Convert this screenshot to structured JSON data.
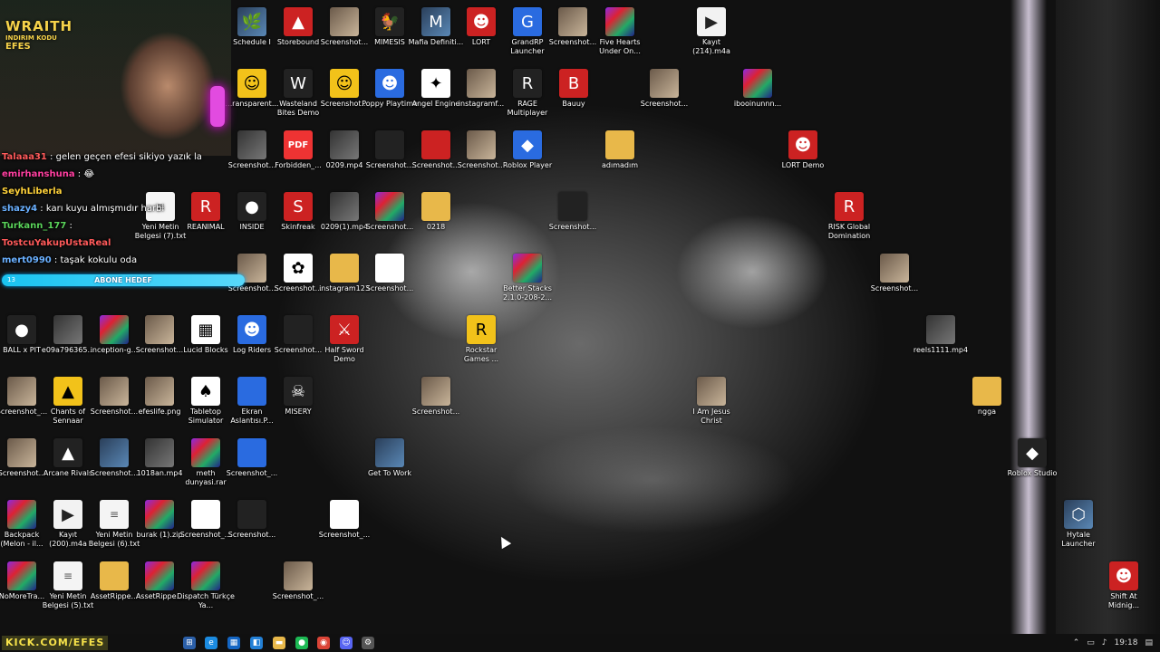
{
  "overlay": {
    "brand_line1": "WRAITH",
    "brand_line2": "INDIRIM KODU",
    "brand_line3": "EFES",
    "chat": [
      {
        "user": "Talaaa31",
        "text": " : gelen geçen efesi sikiyo yazık la",
        "color": "#ff5a5a"
      },
      {
        "user": "emirhanshuna",
        "text": " : 😂",
        "color": "#ff3fa0"
      },
      {
        "user": "SeyhLiberla",
        "text": "",
        "color": "#ffd23a"
      },
      {
        "user": "shazy4",
        "text": " : karı kuyu almışmıdır harbi",
        "color": "#6ab0ff"
      },
      {
        "user": "Turkann_177",
        "text": " :",
        "color": "#5ad35a"
      },
      {
        "user": "TostcuYakupUstaReal",
        "text": "",
        "color": "#ff5a5a"
      },
      {
        "user": "mert0990",
        "text": " : taşak kokulu oda",
        "color": "#6ab0ff"
      }
    ],
    "goal_label": "ABONE HEDEF",
    "goal_count": "13",
    "footer_url": "KICK.COM/EFES"
  },
  "icons": [
    {
      "label": "Schedule I",
      "kind": "c-game",
      "glyph": "🌿"
    },
    {
      "label": "Storebound",
      "kind": "c-red",
      "glyph": "▲"
    },
    {
      "label": "Screenshot...",
      "kind": "c-shot",
      "glyph": ""
    },
    {
      "label": "MIMESIS",
      "kind": "c-dark",
      "glyph": "🐓"
    },
    {
      "label": "Mafia Definiti...",
      "kind": "c-game",
      "glyph": "M"
    },
    {
      "label": "LORT",
      "kind": "c-red",
      "glyph": "☻"
    },
    {
      "label": "GrandRP Launcher",
      "kind": "c-blue",
      "glyph": "G"
    },
    {
      "label": "Screenshot...",
      "kind": "c-shot",
      "glyph": ""
    },
    {
      "label": "Five Hearts Under On...",
      "kind": "c-rar",
      "glyph": ""
    },
    {
      "label": "Kayıt (214).m4a",
      "kind": "c-m4a",
      "glyph": "▶"
    },
    {
      "label": "...ransparent...",
      "kind": "c-yellow",
      "glyph": "☺"
    },
    {
      "label": "Wasteland Bites Demo",
      "kind": "c-dark",
      "glyph": "W"
    },
    {
      "label": "Screenshot...",
      "kind": "c-yellow",
      "glyph": "☺"
    },
    {
      "label": "Poppy Playtime",
      "kind": "c-blue",
      "glyph": "☻"
    },
    {
      "label": "Angel Engine",
      "kind": "c-white",
      "glyph": "✦"
    },
    {
      "label": "instagramf...",
      "kind": "c-shot",
      "glyph": ""
    },
    {
      "label": "RAGE Multiplayer",
      "kind": "c-dark",
      "glyph": "R"
    },
    {
      "label": "Bauuy",
      "kind": "c-red",
      "glyph": "B"
    },
    {
      "label": "Screenshot...",
      "kind": "c-shot",
      "glyph": ""
    },
    {
      "label": "ibooinunnn...",
      "kind": "c-rar",
      "glyph": ""
    },
    {
      "label": "Screenshot...",
      "kind": "c-vid",
      "glyph": ""
    },
    {
      "label": "Forbidden_...",
      "kind": "c-pdf",
      "glyph": "PDF"
    },
    {
      "label": "0209.mp4",
      "kind": "c-vid",
      "glyph": ""
    },
    {
      "label": "Screenshot...",
      "kind": "c-dark",
      "glyph": ""
    },
    {
      "label": "Screenshot...",
      "kind": "c-shot",
      "glyph": ""
    },
    {
      "label": "Screenshot...",
      "kind": "c-red",
      "glyph": ""
    },
    {
      "label": "Roblox Player",
      "kind": "c-blue",
      "glyph": "◆"
    },
    {
      "label": "adımadım",
      "kind": "c-folder",
      "glyph": ""
    },
    {
      "label": "LORT Demo",
      "kind": "c-red",
      "glyph": "☻"
    },
    {
      "label": "Yeni Metin Belgesi (7).txt",
      "kind": "c-txt",
      "glyph": "≡"
    },
    {
      "label": "REANIMAL",
      "kind": "c-red",
      "glyph": "R"
    },
    {
      "label": "INSIDE",
      "kind": "c-dark",
      "glyph": "●"
    },
    {
      "label": "Skinfreak",
      "kind": "c-red",
      "glyph": "S"
    },
    {
      "label": "0209(1).mp4",
      "kind": "c-vid",
      "glyph": ""
    },
    {
      "label": "Screenshot...",
      "kind": "c-rar",
      "glyph": ""
    },
    {
      "label": "0218",
      "kind": "c-folder",
      "glyph": ""
    },
    {
      "label": "Screenshot...",
      "kind": "c-dark",
      "glyph": ""
    },
    {
      "label": "RISK Global Domination",
      "kind": "c-red",
      "glyph": "R"
    },
    {
      "label": "Screenshot...",
      "kind": "c-shot",
      "glyph": ""
    },
    {
      "label": "Screenshot...",
      "kind": "c-white",
      "glyph": "✿"
    },
    {
      "label": "instagram123",
      "kind": "c-folder",
      "glyph": ""
    },
    {
      "label": "Screenshot...",
      "kind": "c-white",
      "glyph": ""
    },
    {
      "label": "Better Stacks 2.1.0-208-2...",
      "kind": "c-rar",
      "glyph": ""
    },
    {
      "label": "Screenshot...",
      "kind": "c-shot",
      "glyph": ""
    },
    {
      "label": "BALL x PIT",
      "kind": "c-dark",
      "glyph": "●"
    },
    {
      "label": "e09a796365...",
      "kind": "c-vid",
      "glyph": ""
    },
    {
      "label": "inception-g...",
      "kind": "c-rar",
      "glyph": ""
    },
    {
      "label": "Screenshot...",
      "kind": "c-shot",
      "glyph": ""
    },
    {
      "label": "Lucid Blocks",
      "kind": "c-white",
      "glyph": "▦"
    },
    {
      "label": "Log Riders",
      "kind": "c-blue",
      "glyph": "☻"
    },
    {
      "label": "Screenshot...",
      "kind": "c-dark",
      "glyph": ""
    },
    {
      "label": "Half Sword Demo",
      "kind": "c-red",
      "glyph": "⚔"
    },
    {
      "label": "Rockstar Games ...",
      "kind": "c-yellow",
      "glyph": "R"
    },
    {
      "label": "reels1111.mp4",
      "kind": "c-vid",
      "glyph": ""
    },
    {
      "label": "Screenshot_...",
      "kind": "c-shot",
      "glyph": ""
    },
    {
      "label": "Chants of Sennaar",
      "kind": "c-yellow",
      "glyph": "▲"
    },
    {
      "label": "Screenshot...",
      "kind": "c-shot",
      "glyph": ""
    },
    {
      "label": "efeslife.png",
      "kind": "c-shot",
      "glyph": ""
    },
    {
      "label": "Tabletop Simulator",
      "kind": "c-white",
      "glyph": "♠"
    },
    {
      "label": "Ekran Aslantısı.P...",
      "kind": "c-blue",
      "glyph": ""
    },
    {
      "label": "MISERY",
      "kind": "c-dark",
      "glyph": "☠"
    },
    {
      "label": "Screenshot...",
      "kind": "c-shot",
      "glyph": ""
    },
    {
      "label": "I Am Jesus Christ",
      "kind": "c-shot",
      "glyph": ""
    },
    {
      "label": "ngga",
      "kind": "c-folder",
      "glyph": ""
    },
    {
      "label": "Screenshot...",
      "kind": "c-shot",
      "glyph": ""
    },
    {
      "label": "Arcane Rivals",
      "kind": "c-dark",
      "glyph": "▲"
    },
    {
      "label": "Screenshot...",
      "kind": "c-game",
      "glyph": ""
    },
    {
      "label": "1018an.mp4",
      "kind": "c-vid",
      "glyph": ""
    },
    {
      "label": "meth dunyasi.rar",
      "kind": "c-rar",
      "glyph": ""
    },
    {
      "label": "Screenshot_...",
      "kind": "c-blue",
      "glyph": ""
    },
    {
      "label": "Get To Work",
      "kind": "c-game",
      "glyph": ""
    },
    {
      "label": "Roblox Studio",
      "kind": "c-dark",
      "glyph": "◆"
    },
    {
      "label": "Backpack (Melon - il...",
      "kind": "c-rar",
      "glyph": ""
    },
    {
      "label": "Kayıt (200).m4a",
      "kind": "c-m4a",
      "glyph": "▶"
    },
    {
      "label": "Yeni Metin Belgesi (6).txt",
      "kind": "c-txt",
      "glyph": "≡"
    },
    {
      "label": "burak (1).zip",
      "kind": "c-rar",
      "glyph": ""
    },
    {
      "label": "Screenshot_...",
      "kind": "c-white",
      "glyph": ""
    },
    {
      "label": "Screenshot...",
      "kind": "c-dark",
      "glyph": ""
    },
    {
      "label": "Screenshot_...",
      "kind": "c-white",
      "glyph": ""
    },
    {
      "label": "Hytale Launcher",
      "kind": "c-game",
      "glyph": "⬡"
    },
    {
      "label": "NoMoreTra...",
      "kind": "c-rar",
      "glyph": ""
    },
    {
      "label": "Yeni Metin Belgesi (5).txt",
      "kind": "c-txt",
      "glyph": "≡"
    },
    {
      "label": "AssetRippe...",
      "kind": "c-folder",
      "glyph": ""
    },
    {
      "label": "AssetRippe...",
      "kind": "c-rar",
      "glyph": ""
    },
    {
      "label": "Dispatch Türkçe Ya...",
      "kind": "c-rar",
      "glyph": ""
    },
    {
      "label": "Screenshot_...",
      "kind": "c-shot",
      "glyph": ""
    },
    {
      "label": "Shift At Midnig...",
      "kind": "c-red",
      "glyph": "☻"
    }
  ],
  "taskbar": {
    "apps": [
      {
        "name": "start-icon",
        "glyph": "⊞",
        "color": "#2b5fa8"
      },
      {
        "name": "edge-icon",
        "glyph": "e",
        "color": "#1b8be0"
      },
      {
        "name": "store-icon",
        "glyph": "▦",
        "color": "#1466c4"
      },
      {
        "name": "vscode-icon",
        "glyph": "◧",
        "color": "#2380d6"
      },
      {
        "name": "file-explorer-icon",
        "glyph": "▬",
        "color": "#e8b84a"
      },
      {
        "name": "spotify-icon",
        "glyph": "●",
        "color": "#1db954"
      },
      {
        "name": "chrome-icon",
        "glyph": "◉",
        "color": "#db4437"
      },
      {
        "name": "discord-icon",
        "glyph": "☺",
        "color": "#5865f2"
      },
      {
        "name": "steam-icon",
        "glyph": "⚙",
        "color": "#555"
      }
    ],
    "clock": "19:18"
  }
}
